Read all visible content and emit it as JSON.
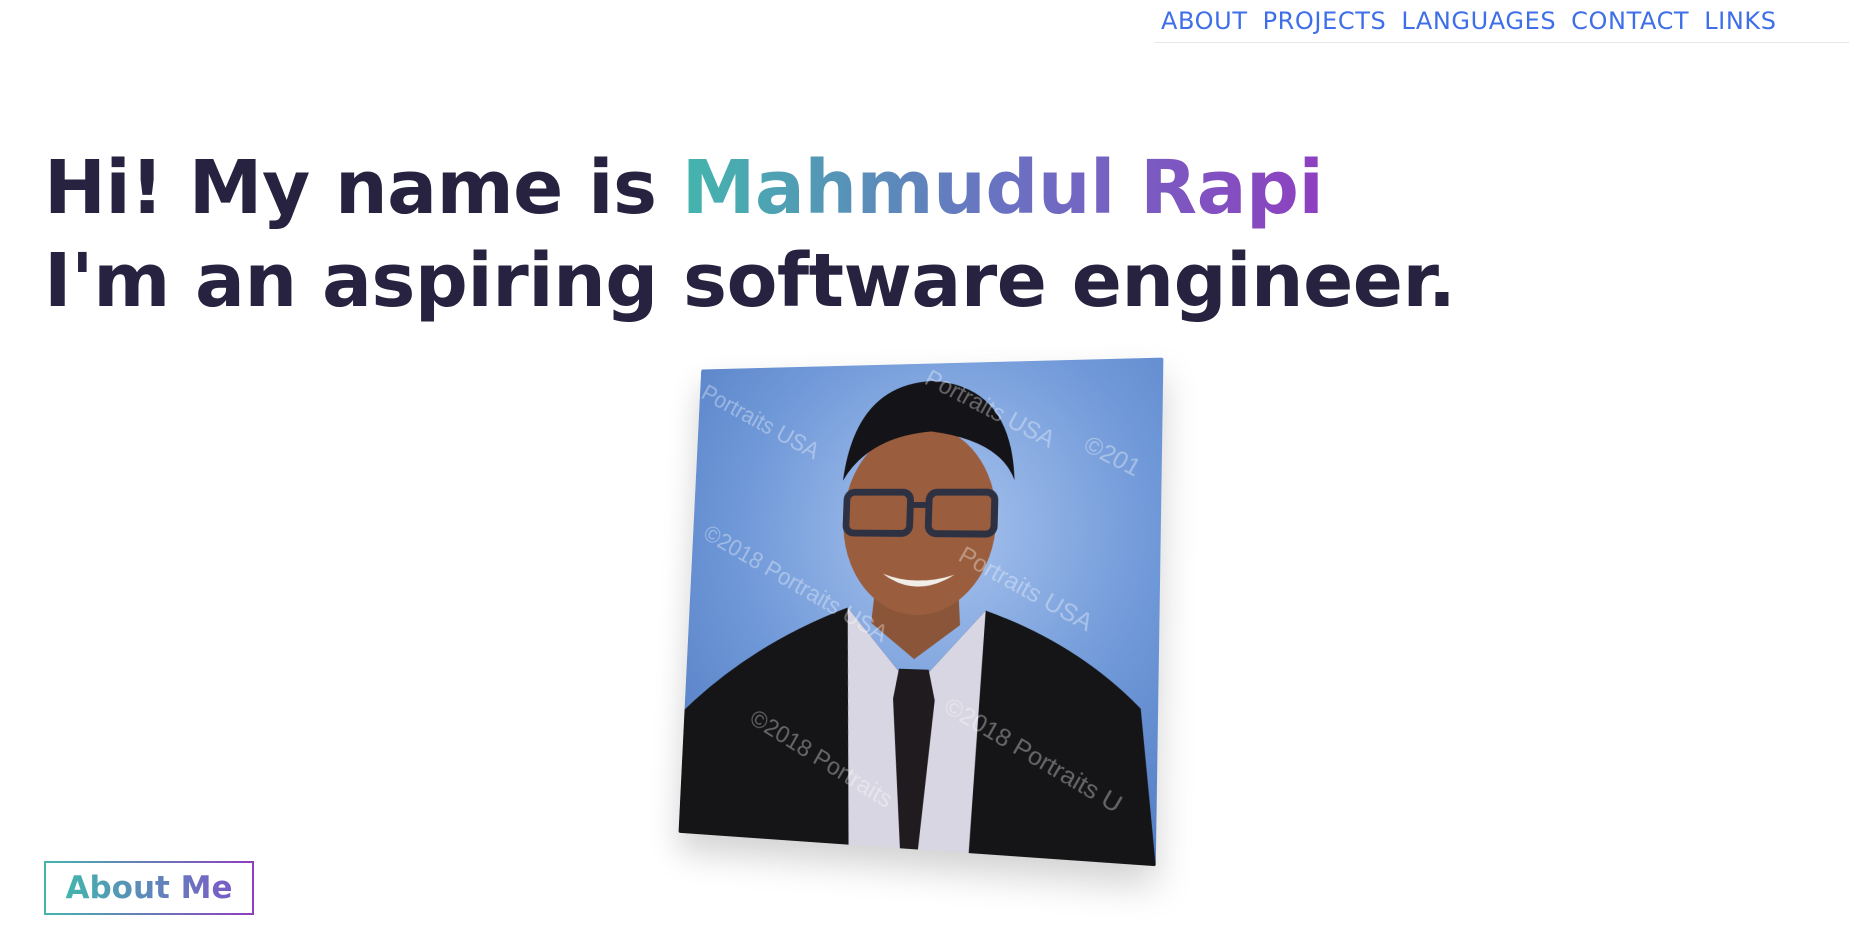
{
  "nav": {
    "items": [
      {
        "label": "ABOUT"
      },
      {
        "label": "PROJECTS"
      },
      {
        "label": "LANGUAGES"
      },
      {
        "label": "CONTACT"
      },
      {
        "label": "LINKS"
      }
    ],
    "link_color": "#3f6fe8"
  },
  "hero": {
    "intro": "Hi! My name is ",
    "name": "Mahmudul Rapi",
    "tagline": "I'm an aspiring software engineer.",
    "text_color": "#26223f",
    "gradient_start": "#43b5ad",
    "gradient_end": "#8e3fc0"
  },
  "photo": {
    "watermark": "©2018 Portraits USA"
  },
  "about_button": {
    "label": "About Me"
  }
}
